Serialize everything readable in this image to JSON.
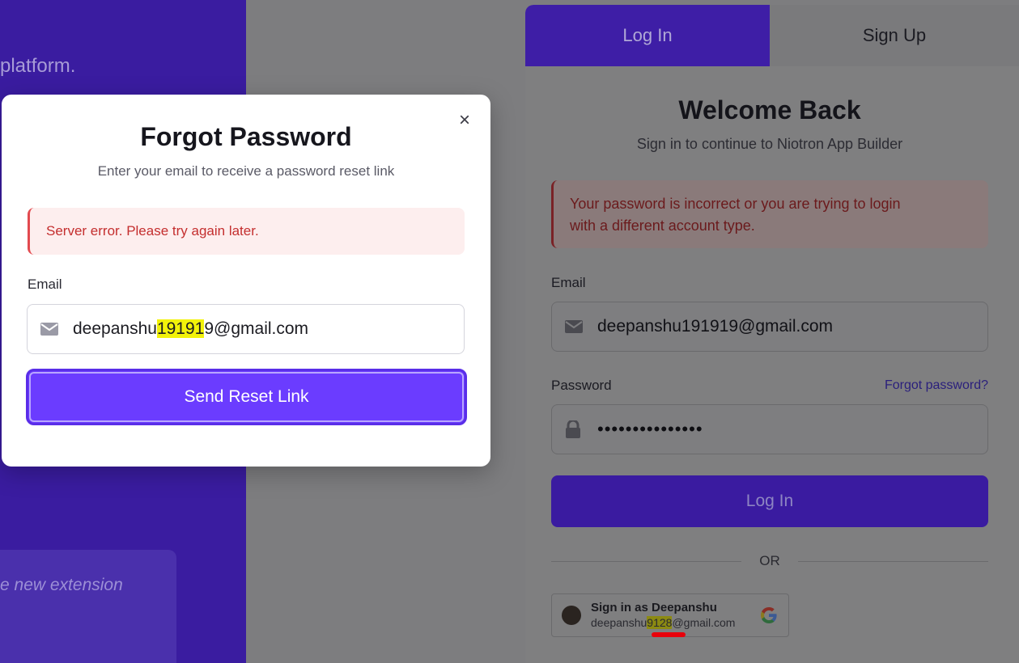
{
  "brand": {
    "tagline": "platform.",
    "card_text": "e new extension"
  },
  "auth": {
    "tabs": [
      {
        "label": "Log In"
      },
      {
        "label": "Sign Up"
      }
    ],
    "title": "Welcome Back",
    "subtitle": "Sign in to continue to Niotron App Builder",
    "error_line1": "Your password is incorrect or you are trying to login",
    "error_line2": "with a different account type.",
    "email_label": "Email",
    "email_value": "deepanshu191919@gmail.com",
    "password_label": "Password",
    "forgot_link": "Forgot password?",
    "password_dots": "•••••••••••••••",
    "login_button": "Log In",
    "or_text": "OR",
    "google": {
      "name": "Sign in as Deepanshu",
      "email_prefix": "deepanshu",
      "email_highlight": "9128",
      "email_suffix": "@gmail.com"
    }
  },
  "modal": {
    "title": "Forgot Password",
    "subtitle": "Enter your email to receive a password reset link",
    "error": "Server error. Please try again later.",
    "email_label": "Email",
    "email_prefix": "deepanshu",
    "email_highlight": "19191",
    "email_suffix": "9@gmail.com",
    "send_button": "Send Reset Link",
    "close_symbol": "×"
  },
  "colors": {
    "accent": "#6b3cff",
    "error_text": "#c42e2e",
    "error_bg": "#fdeeee",
    "highlight": "#f2f20a"
  }
}
